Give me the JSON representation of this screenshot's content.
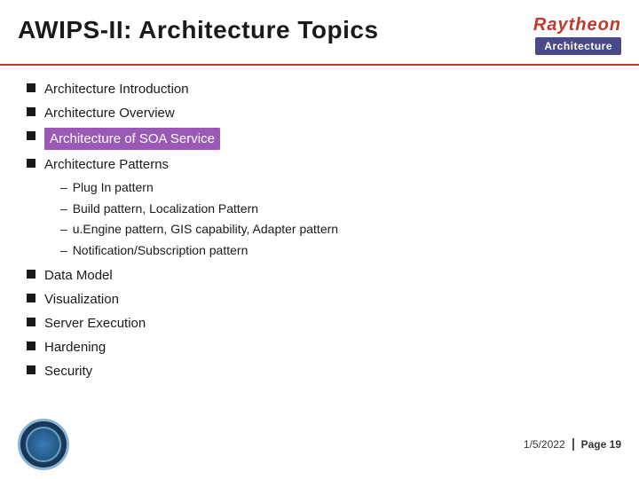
{
  "header": {
    "title": "AWIPS-II: Architecture Topics",
    "logo": "Raytheon",
    "badge": "Architecture"
  },
  "bullets": [
    {
      "text": "Architecture Introduction",
      "highlighted": false
    },
    {
      "text": "Architecture Overview",
      "highlighted": false
    },
    {
      "text": "Architecture of SOA Service",
      "highlighted": true
    },
    {
      "text": "Architecture Patterns",
      "highlighted": false
    }
  ],
  "sub_bullets": [
    "Plug In pattern",
    "Build pattern, Localization Pattern",
    "u.Engine pattern, GIS capability, Adapter pattern",
    "Notification/Subscription pattern"
  ],
  "lower_bullets": [
    "Data Model",
    "Visualization",
    "Server Execution",
    "Hardening",
    "Security"
  ],
  "footer": {
    "date": "1/5/2022",
    "page_label": "Page 19"
  }
}
